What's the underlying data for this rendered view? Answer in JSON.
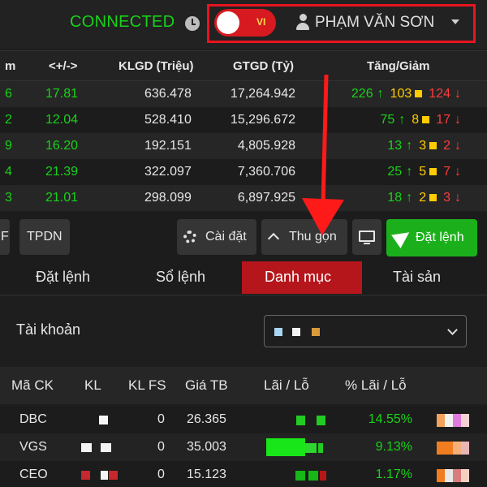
{
  "header": {
    "status": "CONNECTED",
    "language": "VI",
    "user_name": "PHẠM VĂN SƠN"
  },
  "index_table": {
    "columns": [
      "m",
      "<+/->",
      "KLGD (Triệu)",
      "GTGD (Tỷ)",
      "Tăng/Giảm"
    ],
    "rows": [
      {
        "lead": "6",
        "change": "17.81",
        "klgd": "636.478",
        "gtgd": "17,264.942",
        "up": "226",
        "flat": "103",
        "down": "124"
      },
      {
        "lead": "2",
        "change": "12.04",
        "klgd": "528.410",
        "gtgd": "15,296.672",
        "up": "75",
        "flat": "8",
        "down": "17"
      },
      {
        "lead": "9",
        "change": "16.20",
        "klgd": "192.151",
        "gtgd": "4,805.928",
        "up": "13",
        "flat": "3",
        "down": "2"
      },
      {
        "lead": "4",
        "change": "21.39",
        "klgd": "322.097",
        "gtgd": "7,360.706",
        "up": "25",
        "flat": "5",
        "down": "7"
      },
      {
        "lead": "3",
        "change": "21.01",
        "klgd": "298.099",
        "gtgd": "6,897.925",
        "up": "18",
        "flat": "2",
        "down": "3"
      }
    ],
    "up_arrow": "↑",
    "down_arrow": "↓"
  },
  "toolbar": {
    "tpdn": "TPDN",
    "left_partial": "F",
    "settings": "Cài đặt",
    "collapse": "Thu gọn",
    "place_order": "Đặt lệnh"
  },
  "tabs": [
    "Đặt lệnh",
    "Sổ lệnh",
    "Danh mục",
    "Tài sản"
  ],
  "active_tab": 2,
  "account": {
    "label": "Tài khoản"
  },
  "portfolio": {
    "columns": [
      "Mã CK",
      "KL",
      "KL FS",
      "Giá TB",
      "Lãi / Lỗ",
      "% Lãi / Lỗ"
    ],
    "rows": [
      {
        "code": "DBC",
        "kl_fs": "0",
        "avg_price": "26.365",
        "pct": "14.55%"
      },
      {
        "code": "VGS",
        "kl_fs": "0",
        "avg_price": "35.003",
        "pct": "9.13%"
      },
      {
        "code": "CEO",
        "kl_fs": "0",
        "avg_price": "15.123",
        "pct": "1.17%"
      }
    ]
  },
  "colors": {
    "accent_red": "#b5161c",
    "highlight_red": "#e8141f",
    "up_green": "#19d219",
    "flat_yellow": "#ffcc00",
    "down_red": "#ff3b3b",
    "order_green": "#1bb01b"
  },
  "icons": [
    "clock-icon",
    "user-icon",
    "chevron-down-icon",
    "gear-icon",
    "chevron-up-icon",
    "monitor-icon",
    "send-icon",
    "arrow-annotation-icon"
  ]
}
